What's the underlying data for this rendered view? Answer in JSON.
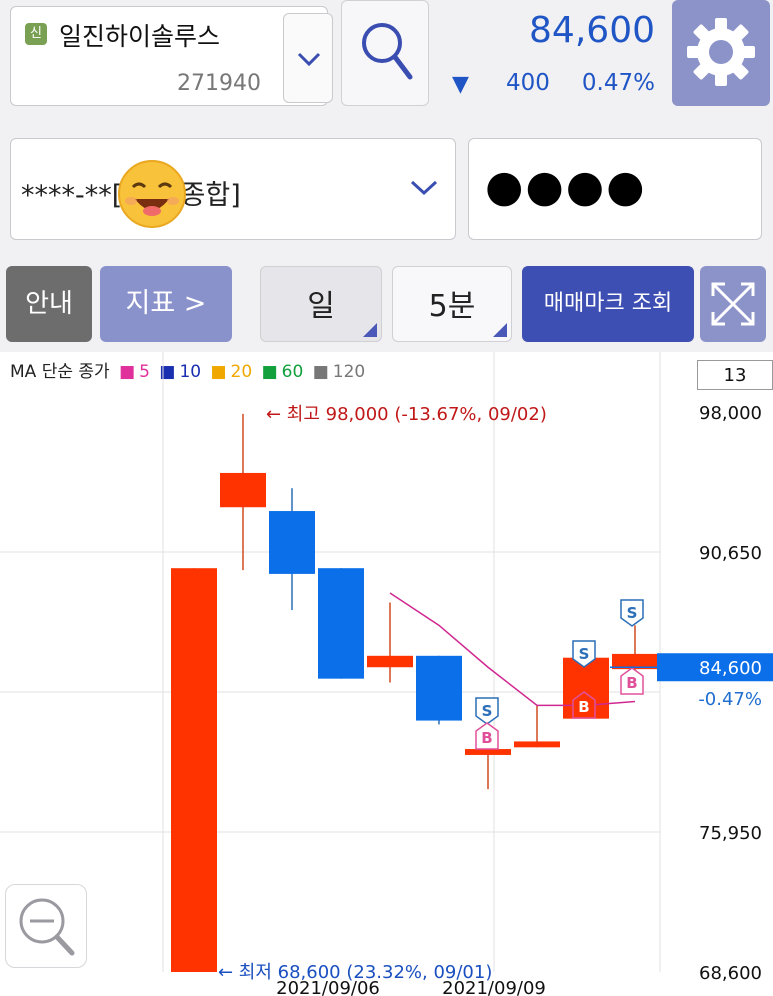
{
  "header": {
    "badge": "신",
    "stock_name": "일진하이솔루스",
    "stock_code": "271940",
    "price": "84,600",
    "change_arrow": "▼",
    "change": "400",
    "change_pct": "0.47%"
  },
  "account": {
    "label": "****-**[ 위탁종합]",
    "password_mask": "●●●●"
  },
  "toolbar": {
    "guide": "안내",
    "indicator": "지표 >",
    "period": "일",
    "interval": "5분",
    "trade_mark": "매매마크 조회"
  },
  "legend": {
    "title": "MA 단순 종가",
    "ma": [
      {
        "label": "5",
        "color": "#e0309b"
      },
      {
        "label": "10",
        "color": "#1a2fb0"
      },
      {
        "label": "20",
        "color": "#f0a800"
      },
      {
        "label": "60",
        "color": "#12a03c"
      },
      {
        "label": "120",
        "color": "#777777"
      }
    ],
    "count": "13"
  },
  "chart_data": {
    "type": "candlestick",
    "ylim": [
      68600,
      98000
    ],
    "y_ticks": [
      "98,000",
      "90,650",
      "75,950",
      "68,600"
    ],
    "x_ticks": [
      "2021/09/06",
      "2021/09/09"
    ],
    "current_price_label": "84,600",
    "current_change_label": "-0.47%",
    "high_annotation": "← 최고 98,000 (-13.67%, 09/02)",
    "low_annotation": "← 최저 68,600 (23.32%, 09/01)",
    "up_color": "#ff3300",
    "down_color": "#0a6fe8",
    "candles": [
      {
        "open": 68600,
        "close": 89800,
        "high": 89800,
        "low": 68600
      },
      {
        "open": 93000,
        "close": 94800,
        "high": 97900,
        "low": 89700
      },
      {
        "open": 92800,
        "close": 89500,
        "high": 94000,
        "low": 87600
      },
      {
        "open": 89800,
        "close": 84000,
        "high": 89800,
        "low": 84000
      },
      {
        "open": 84600,
        "close": 85200,
        "high": 88000,
        "low": 83800
      },
      {
        "open": 85200,
        "close": 81800,
        "high": 85200,
        "low": 81600
      },
      {
        "open": 80100,
        "close": 80200,
        "high": 81500,
        "low": 78200
      },
      {
        "open": 80500,
        "close": 80600,
        "high": 82600,
        "low": 80400
      },
      {
        "open": 81900,
        "close": 85100,
        "high": 86000,
        "low": 81900
      },
      {
        "open": 84500,
        "close": 85300,
        "high": 86800,
        "low": 84300
      }
    ],
    "ma5_line": [
      null,
      null,
      null,
      null,
      88500,
      86800,
      84600,
      82600,
      82600,
      82800
    ],
    "trade_marks": [
      {
        "candle": 6,
        "label": "S",
        "type": "sell"
      },
      {
        "candle": 6,
        "label": "B",
        "type": "buy"
      },
      {
        "candle": 8,
        "label": "S",
        "type": "sell"
      },
      {
        "candle": 8,
        "label": "B",
        "type": "buy"
      },
      {
        "candle": 9,
        "label": "S",
        "type": "sell"
      },
      {
        "candle": 9,
        "label": "B",
        "type": "buy"
      }
    ]
  }
}
